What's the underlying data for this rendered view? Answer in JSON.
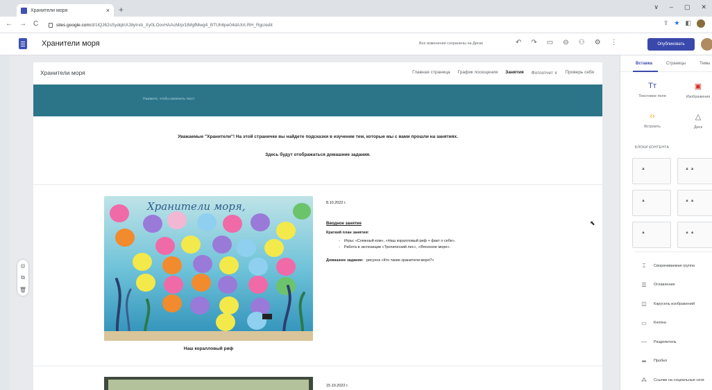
{
  "browser": {
    "tab_title": "Хранители моря",
    "tab_close": "×",
    "new_tab": "+",
    "window_controls": [
      "∨",
      "–",
      "▢",
      "✕"
    ],
    "url_host": "sites.google.com",
    "url_path": "/d/1lQJ62sSydqlnXJ8yIrxb_Xy0LOovHAAcM/p/1tMgfMwg4_BTUh6pe04dAXrt-RH_Rgc/edit",
    "nav_icons": [
      "←",
      "→",
      "C"
    ]
  },
  "editor": {
    "doc_title": "Хранители моря",
    "saved_status": "Все изменения сохранены на Диске",
    "publish_label": "Опубликовать",
    "tool_icons": [
      "↶",
      "↷",
      "▭",
      "⊖",
      "⚇",
      "⚙",
      "⋮"
    ]
  },
  "site": {
    "name": "Хранители моря",
    "nav": [
      {
        "label": "Главная страница"
      },
      {
        "label": "График посещения"
      },
      {
        "label": "Занятия"
      },
      {
        "label": "Фотоотчет ∨"
      },
      {
        "label": "Проверь себя"
      }
    ],
    "banner_hint": "Нажмите, чтобы изменить текст",
    "intro_line1": "Уважаемые \"Хранители\"! На этой страничке вы найдете подсказки в изучении тем, которые мы с вами прошли на занятиях.",
    "intro_line2": "Здесь будут отображаться домашние задания.",
    "photo_title": "Хранители моря,",
    "photo_caption": "Наш коралловый риф",
    "lesson1": {
      "date": "8.10.2022 г.",
      "title": "Вводное занятие",
      "plan_label": "Краткий план занятия:",
      "plan_items": [
        "Игры: «Снежный ком», «Наш коралловый риф + факт о себе».",
        "Работа в экспозиции «Тропический лес», «Японское море»."
      ],
      "homework_label": "Домашнее задание:",
      "homework_text": "рисунок «Кто такие хранители моря?»"
    },
    "lesson2": {
      "date": "15.10.2022 г."
    }
  },
  "panel": {
    "tabs": [
      "Вставка",
      "Страницы",
      "Темы"
    ],
    "insert_tiles": [
      {
        "label": "Текстовое поле",
        "icon": "Tт"
      },
      {
        "label": "Изображения",
        "icon": "▣"
      },
      {
        "label": "Встроить",
        "icon": "‹›"
      },
      {
        "label": "Диск",
        "icon": "△"
      }
    ],
    "blocks_label": "БЛОКИ КОНТЕНТА",
    "items": [
      {
        "label": "Сворачиваемая группа",
        "icon": "⌶"
      },
      {
        "label": "Оглавление",
        "icon": "☰"
      },
      {
        "label": "Карусель изображений",
        "icon": "◫"
      },
      {
        "label": "Кнопка",
        "icon": "▭"
      },
      {
        "label": "Разделитель",
        "icon": "—"
      },
      {
        "label": "Пробел",
        "icon": "⇹"
      },
      {
        "label": "Ссылки на социальные сети",
        "icon": "⁂"
      }
    ]
  },
  "colors": {
    "banner": "#2c7589",
    "publish": "#3949ab",
    "sites_brand": "#3f51b5"
  }
}
